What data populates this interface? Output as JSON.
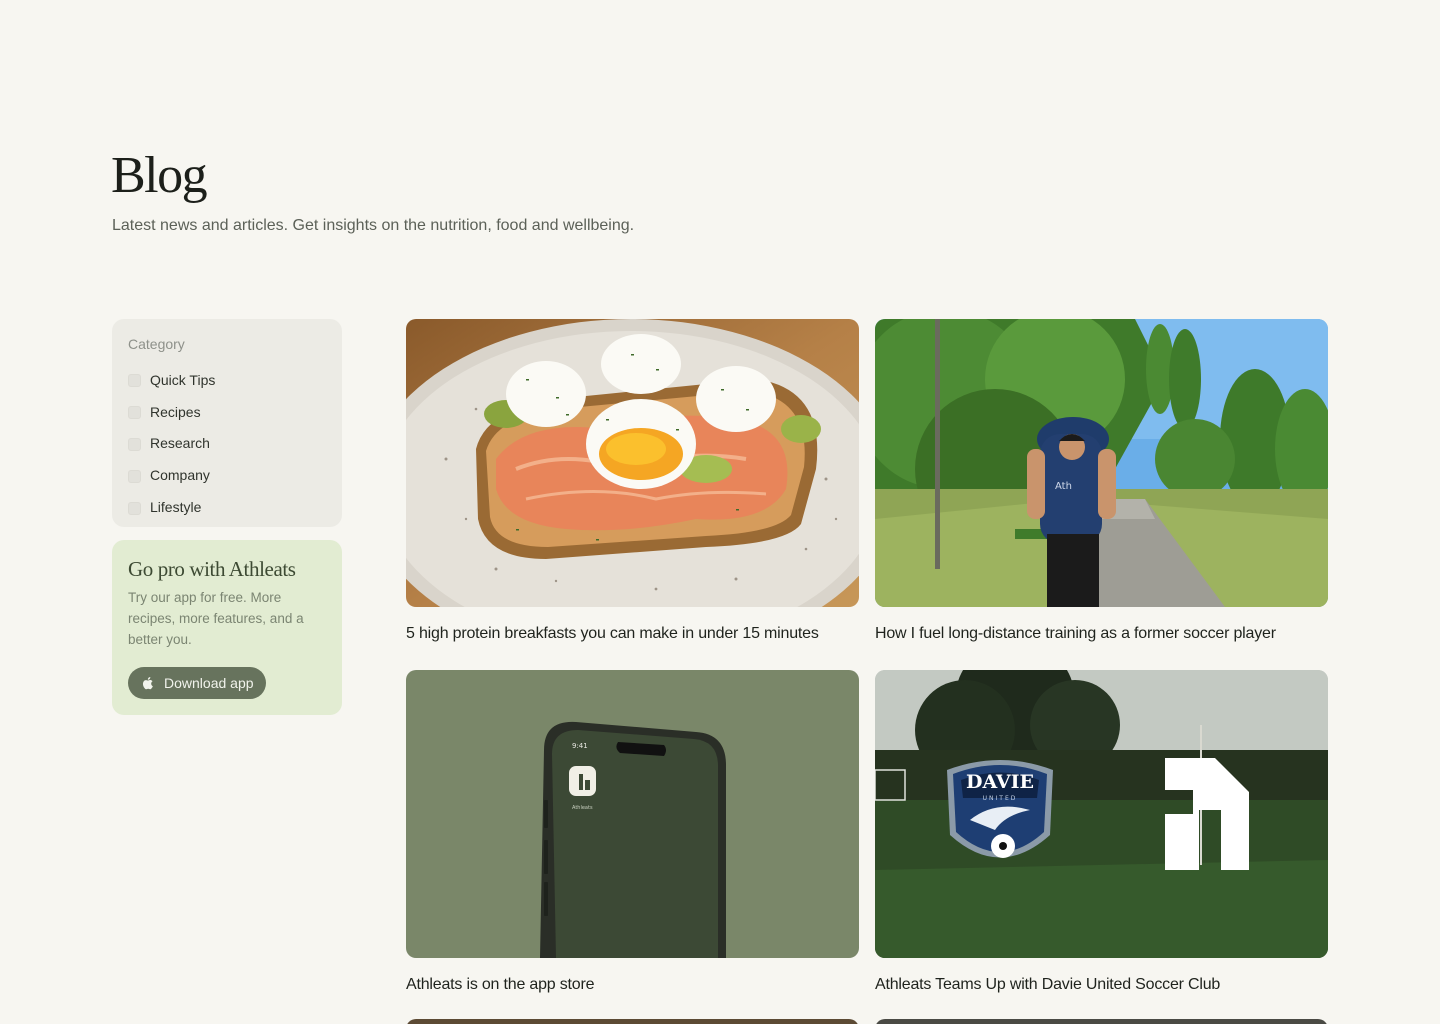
{
  "header": {
    "title": "Blog",
    "subtitle": "Latest news and articles. Get insights on the nutrition, food and wellbeing."
  },
  "filters": {
    "heading": "Category",
    "items": [
      {
        "label": "Quick Tips",
        "checked": false
      },
      {
        "label": "Recipes",
        "checked": false
      },
      {
        "label": "Research",
        "checked": false
      },
      {
        "label": "Company",
        "checked": false
      },
      {
        "label": "Lifestyle",
        "checked": false
      }
    ]
  },
  "promo": {
    "title": "Go pro with Athleats",
    "text": "Try our app for free. More recipes, more features, and a better you.",
    "button_label": "Download app",
    "button_icon": "apple-icon"
  },
  "posts": [
    {
      "title": "5 high protein breakfasts you can make in under 15 minutes",
      "image": "poached-eggs-salmon-toast"
    },
    {
      "title": "How I fuel long-distance training as a former soccer player",
      "image": "runner-in-park"
    },
    {
      "title": "Athleats is on the app store",
      "image": "phone-mockup"
    },
    {
      "title": "Athleats Teams Up with Davie United Soccer Club",
      "image": "davie-united-partnership"
    }
  ],
  "phone": {
    "time": "9:41",
    "app_label": "Athleats"
  },
  "davie_badge": {
    "name": "DAVIE",
    "subtitle": "UNITED"
  },
  "colors": {
    "background": "#f7f6f1",
    "promo_background": "#e2ecd2",
    "button": "#67735d",
    "phone_bg": "#7a8769"
  }
}
